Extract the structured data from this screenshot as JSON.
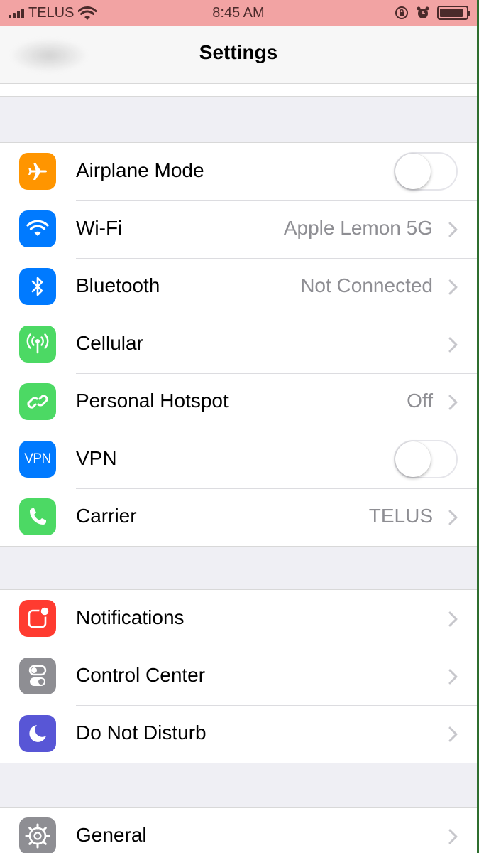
{
  "status_bar": {
    "carrier": "TELUS",
    "time": "8:45 AM",
    "icons": [
      "signal-icon",
      "wifi-icon",
      "rotation-lock-icon",
      "alarm-icon",
      "battery-icon"
    ]
  },
  "nav": {
    "title": "Settings"
  },
  "groups": [
    {
      "rows": [
        {
          "label": "Airplane Mode",
          "icon": "airplane-icon",
          "icon_color": "#ff9500",
          "control": "toggle",
          "toggle_on": false
        },
        {
          "label": "Wi-Fi",
          "icon": "wifi-icon",
          "icon_color": "#007aff",
          "value": "Apple Lemon 5G",
          "control": "chevron"
        },
        {
          "label": "Bluetooth",
          "icon": "bluetooth-icon",
          "icon_color": "#007aff",
          "value": "Not Connected",
          "control": "chevron"
        },
        {
          "label": "Cellular",
          "icon": "cellular-antenna-icon",
          "icon_color": "#4cd964",
          "control": "chevron"
        },
        {
          "label": "Personal Hotspot",
          "icon": "hotspot-icon",
          "icon_color": "#4cd964",
          "value": "Off",
          "control": "chevron"
        },
        {
          "label": "VPN",
          "icon": "vpn-icon",
          "icon_text": "VPN",
          "icon_color": "#007aff",
          "control": "toggle",
          "toggle_on": false
        },
        {
          "label": "Carrier",
          "icon": "phone-icon",
          "icon_color": "#4cd964",
          "value": "TELUS",
          "control": "chevron"
        }
      ]
    },
    {
      "rows": [
        {
          "label": "Notifications",
          "icon": "notifications-icon",
          "icon_color": "#ff3b30",
          "control": "chevron"
        },
        {
          "label": "Control Center",
          "icon": "control-center-icon",
          "icon_color": "#8e8e93",
          "control": "chevron"
        },
        {
          "label": "Do Not Disturb",
          "icon": "moon-icon",
          "icon_color": "#5856d6",
          "control": "chevron"
        }
      ]
    },
    {
      "rows": [
        {
          "label": "General",
          "icon": "gear-icon",
          "icon_color": "#8e8e93",
          "control": "chevron"
        }
      ]
    }
  ]
}
